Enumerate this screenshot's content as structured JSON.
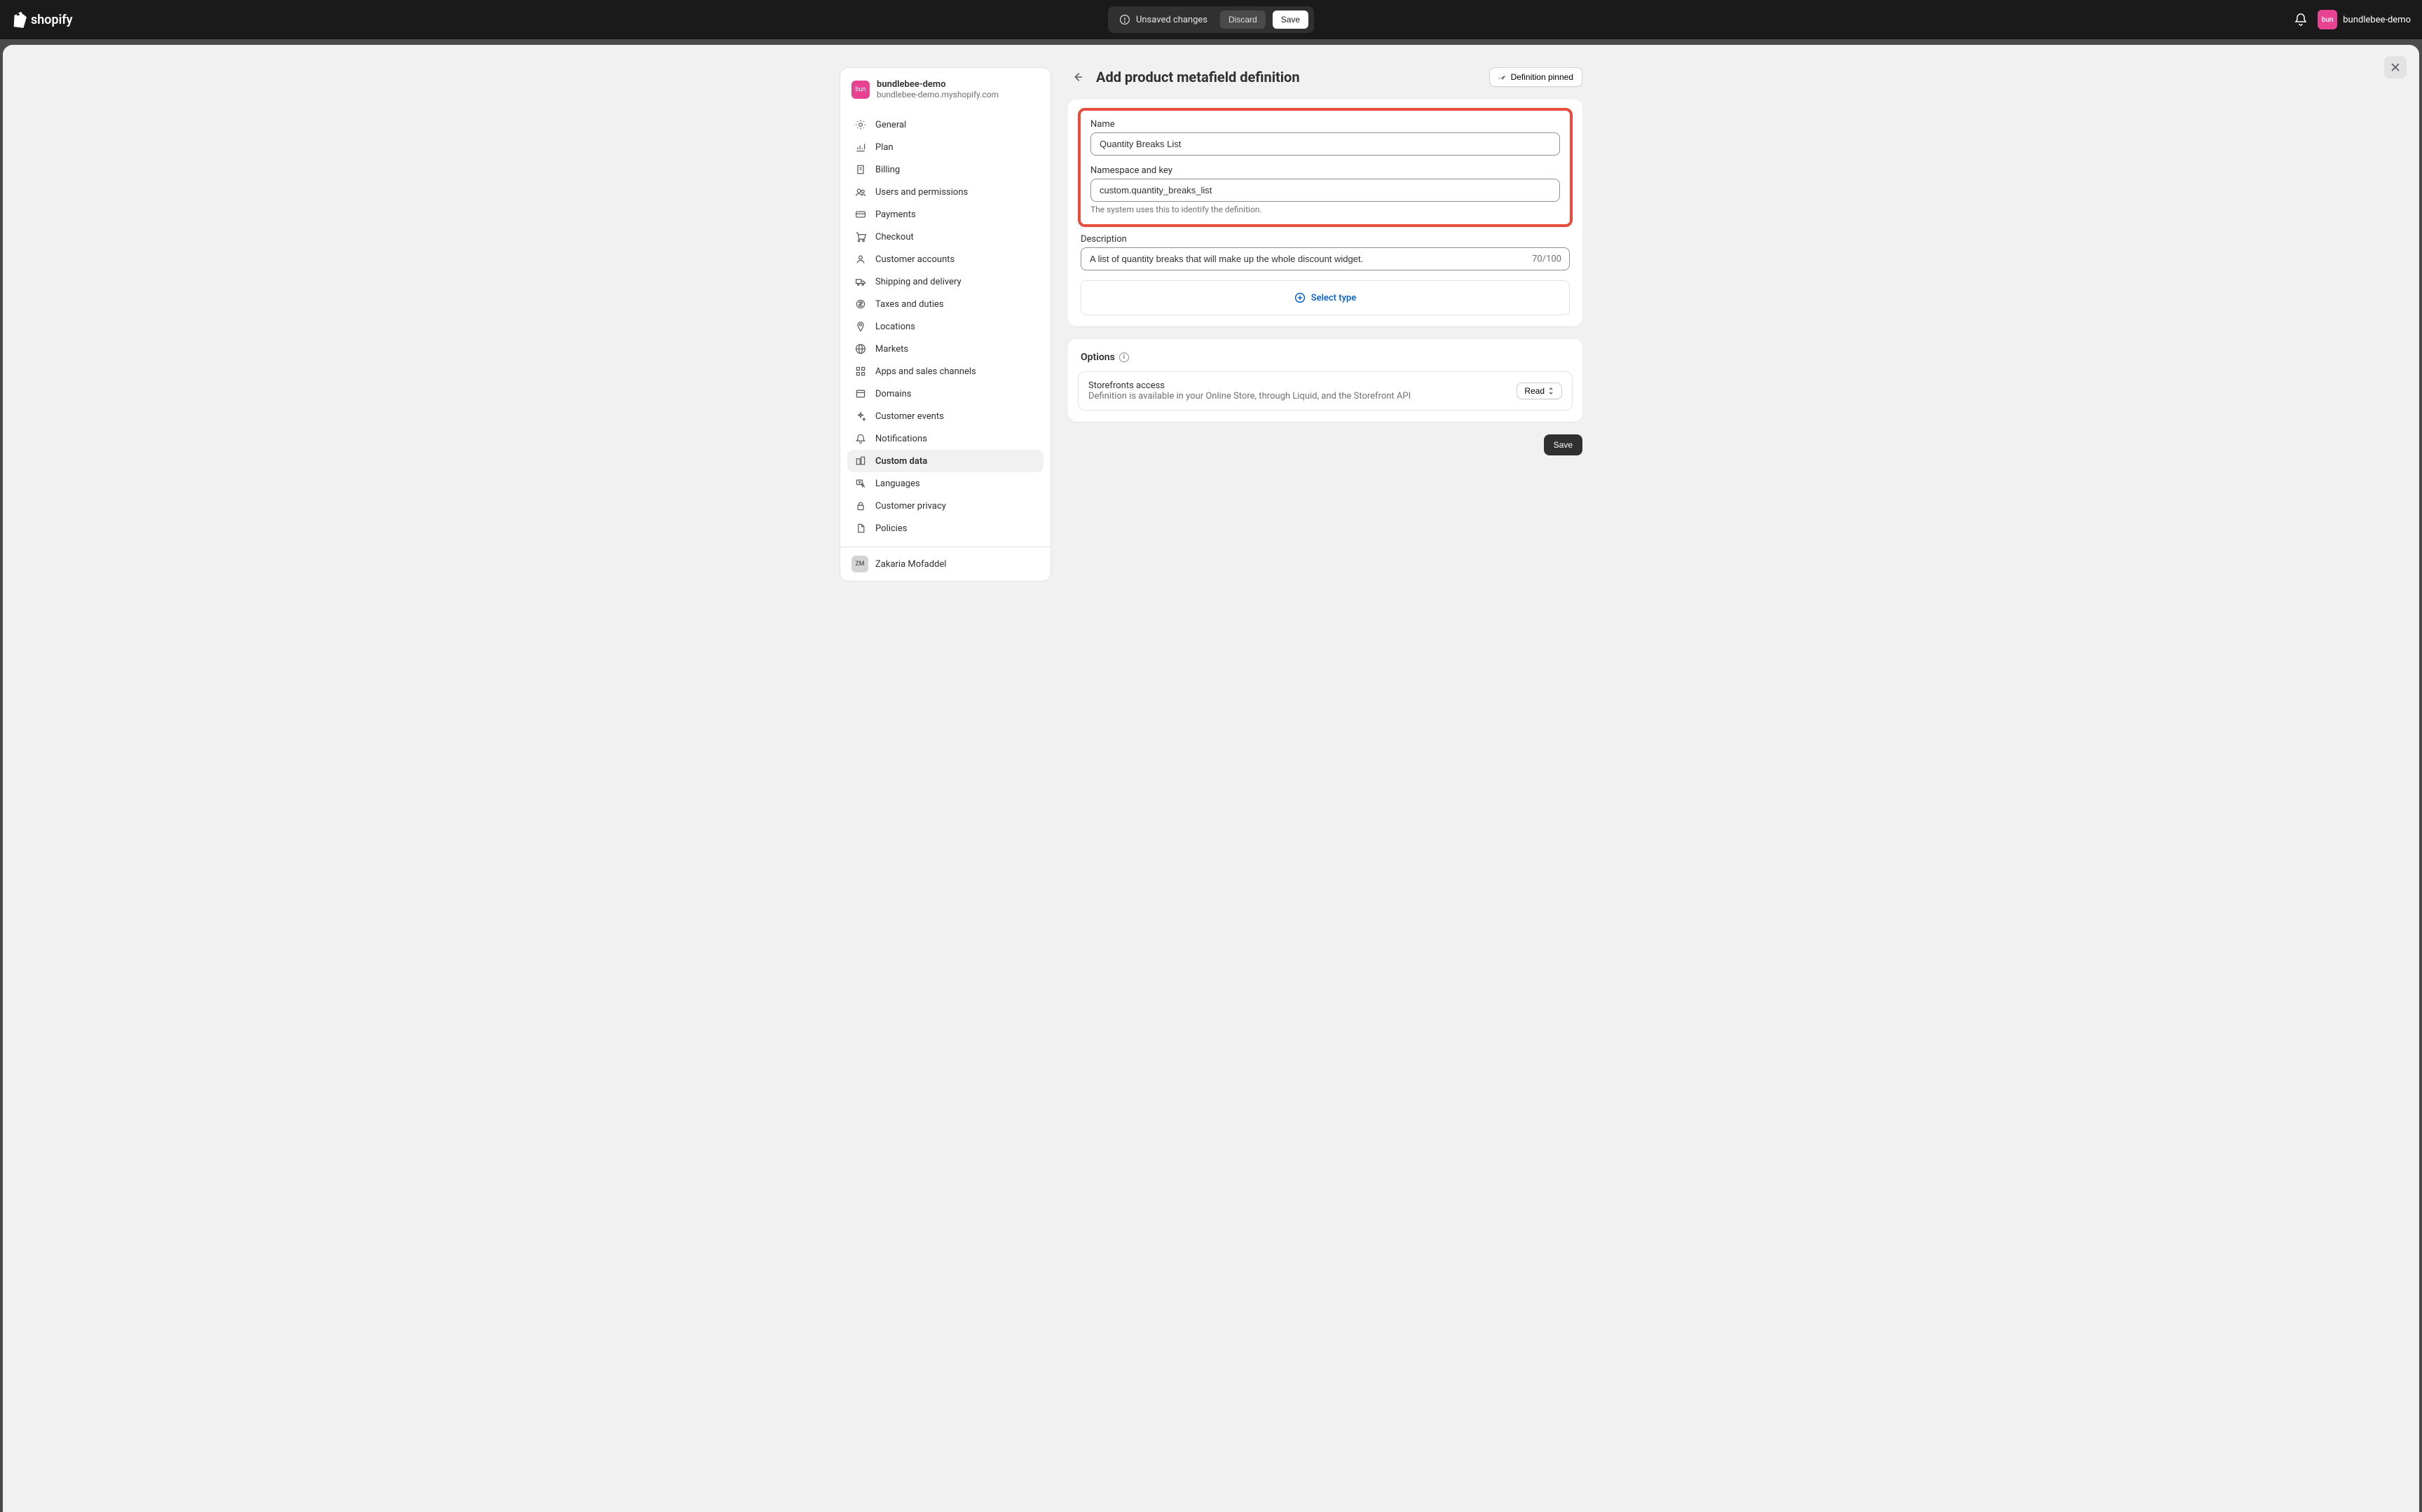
{
  "topbar": {
    "unsaved_label": "Unsaved changes",
    "discard_label": "Discard",
    "save_label": "Save",
    "store_name": "bundlebee-demo",
    "avatar_short": "bun"
  },
  "sidebar": {
    "shop_name": "bundlebee-demo",
    "shop_url": "bundlebee-demo.myshopify.com",
    "shop_avatar_short": "bun",
    "items": [
      {
        "label": "General",
        "icon": "gear"
      },
      {
        "label": "Plan",
        "icon": "chart"
      },
      {
        "label": "Billing",
        "icon": "receipt"
      },
      {
        "label": "Users and permissions",
        "icon": "users"
      },
      {
        "label": "Payments",
        "icon": "card"
      },
      {
        "label": "Checkout",
        "icon": "cart"
      },
      {
        "label": "Customer accounts",
        "icon": "person"
      },
      {
        "label": "Shipping and delivery",
        "icon": "truck"
      },
      {
        "label": "Taxes and duties",
        "icon": "money"
      },
      {
        "label": "Locations",
        "icon": "pin"
      },
      {
        "label": "Markets",
        "icon": "globe"
      },
      {
        "label": "Apps and sales channels",
        "icon": "apps"
      },
      {
        "label": "Domains",
        "icon": "domain"
      },
      {
        "label": "Customer events",
        "icon": "sparkle"
      },
      {
        "label": "Notifications",
        "icon": "bell"
      },
      {
        "label": "Custom data",
        "icon": "data",
        "active": true
      },
      {
        "label": "Languages",
        "icon": "lang"
      },
      {
        "label": "Customer privacy",
        "icon": "lock"
      },
      {
        "label": "Policies",
        "icon": "doc"
      }
    ],
    "user_name": "Zakaria Mofaddel",
    "user_initials": "ZM"
  },
  "page": {
    "title": "Add product metafield definition",
    "pinned_label": "Definition pinned",
    "form": {
      "name_label": "Name",
      "name_value": "Quantity Breaks List",
      "namespace_label": "Namespace and key",
      "namespace_value": "custom.quantity_breaks_list",
      "namespace_help": "The system uses this to identify the definition.",
      "description_label": "Description",
      "description_value": "A list of quantity breaks that will make up the whole discount widget.",
      "description_count": "70/100",
      "select_type_label": "Select type"
    },
    "options": {
      "heading": "Options",
      "storefront_title": "Storefronts access",
      "storefront_desc": "Definition is available in your Online Store, through Liquid, and the Storefront API",
      "read_label": "Read"
    },
    "footer_save": "Save"
  }
}
